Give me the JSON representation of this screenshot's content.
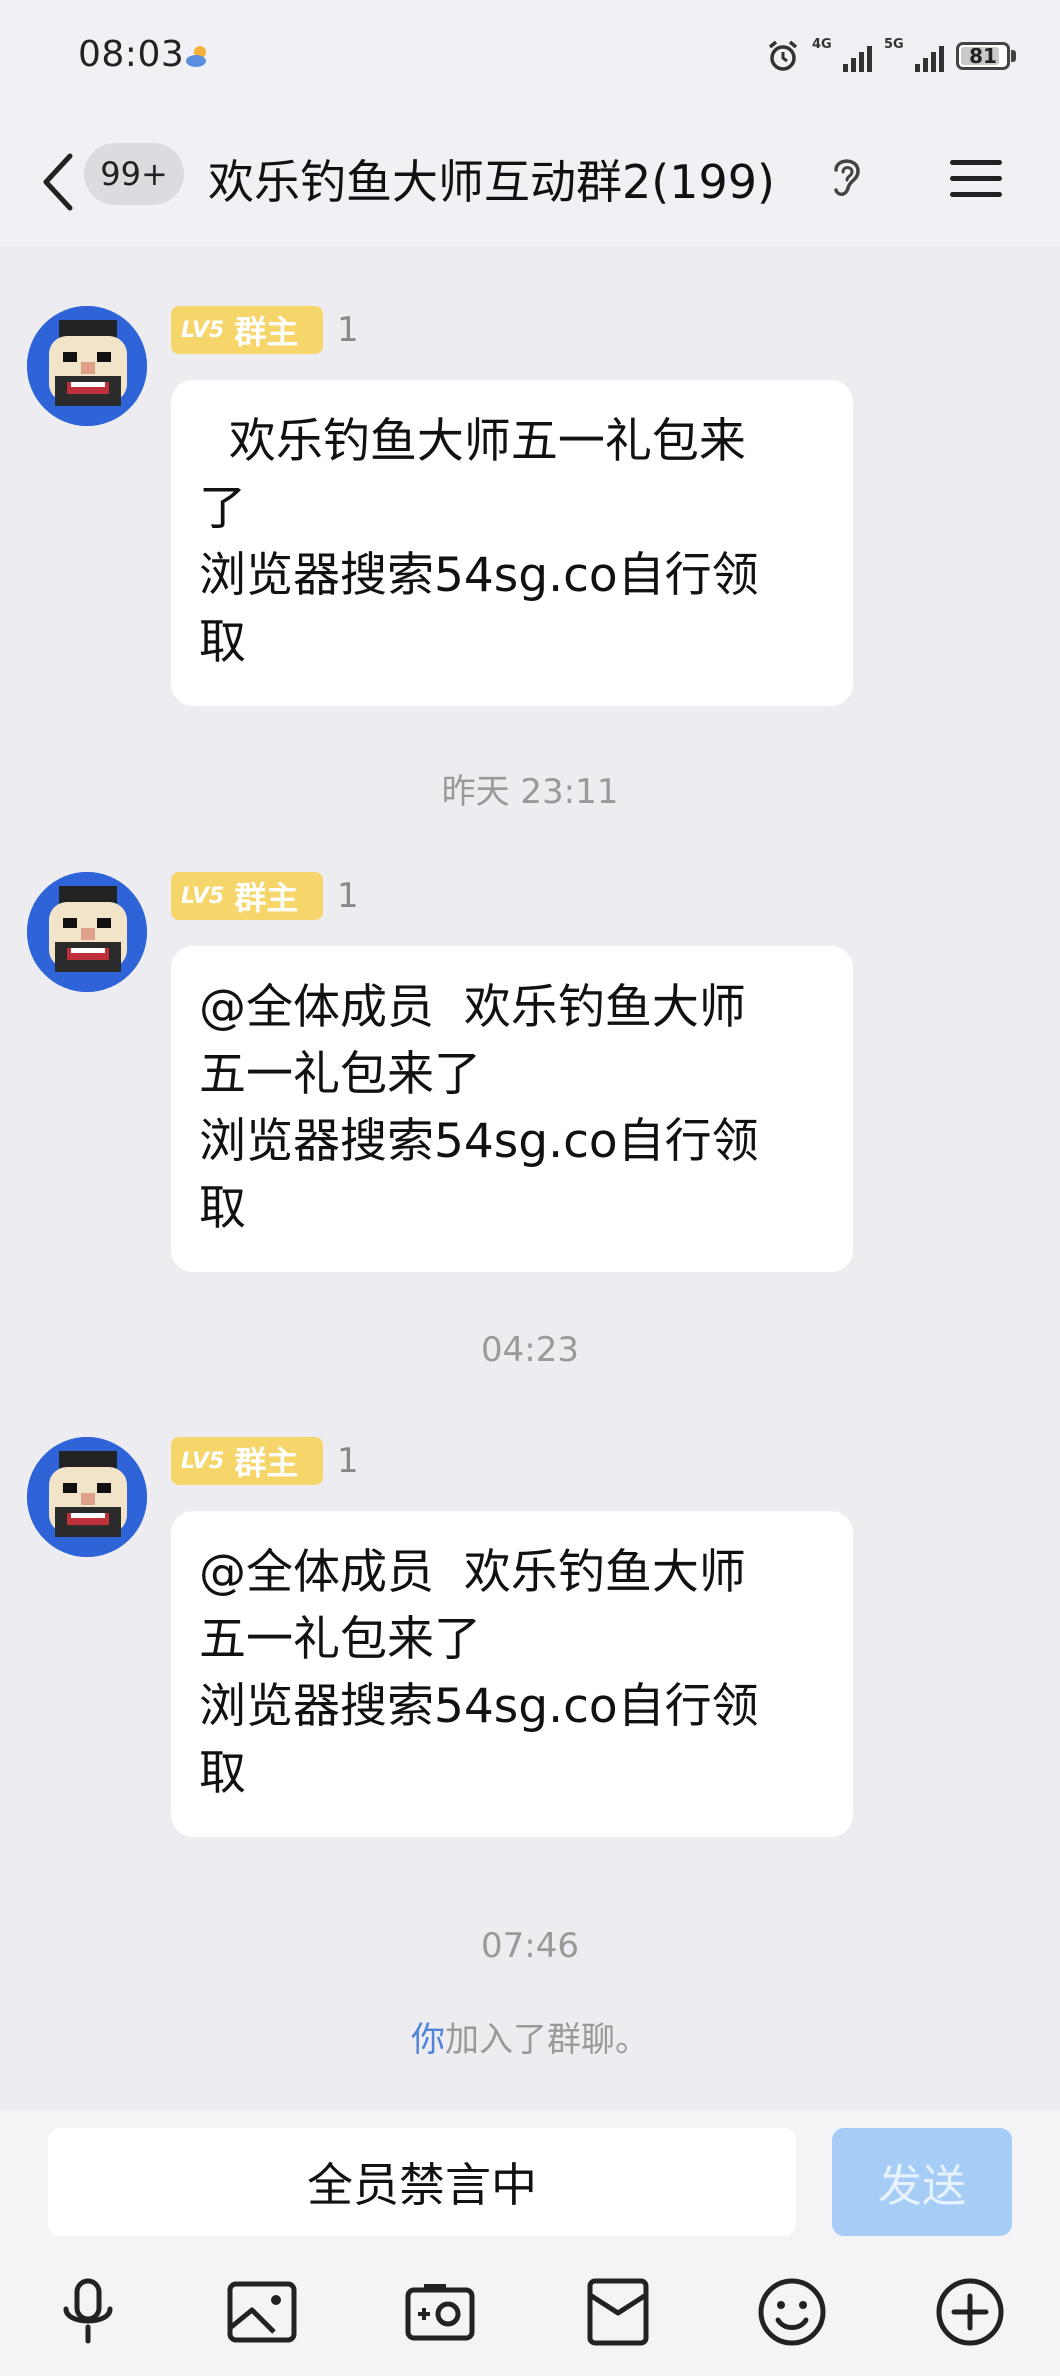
{
  "status_bar": {
    "time": "08:03",
    "net1": "4G",
    "net2": "5G",
    "battery": "81"
  },
  "header": {
    "unread": "99+",
    "title": "欢乐钓鱼大师互动群2(199)"
  },
  "messages": [
    {
      "badge_lv": "LV5",
      "badge_role": "群主",
      "sender": "1",
      "text": "  欢乐钓鱼大师五一礼包来\n了\n浏览器搜索54sg.co自行领\n取"
    },
    {
      "timestamp": "昨天 23:11",
      "badge_lv": "LV5",
      "badge_role": "群主",
      "sender": "1",
      "text": "@全体成员  欢乐钓鱼大师\n五一礼包来了\n浏览器搜索54sg.co自行领\n取"
    },
    {
      "timestamp": "04:23",
      "badge_lv": "LV5",
      "badge_role": "群主",
      "sender": "1",
      "text": "@全体成员  欢乐钓鱼大师\n五一礼包来了\n浏览器搜索54sg.co自行领\n取"
    }
  ],
  "footer_timestamp": "07:46",
  "system_notice": {
    "you": "你",
    "rest": "加入了群聊。"
  },
  "input": {
    "muted_text": "全员禁言中",
    "send_label": "发送"
  },
  "toolbar_icons": [
    "microphone-icon",
    "image-icon",
    "camera-icon",
    "red-packet-icon",
    "emoji-icon",
    "plus-icon"
  ],
  "colors": {
    "background": "#ededf1",
    "badge": "#f6d56b",
    "send_disabled": "#a6cdf6",
    "link_you": "#4f84d8",
    "avatar_bg": "#2f63d8"
  }
}
